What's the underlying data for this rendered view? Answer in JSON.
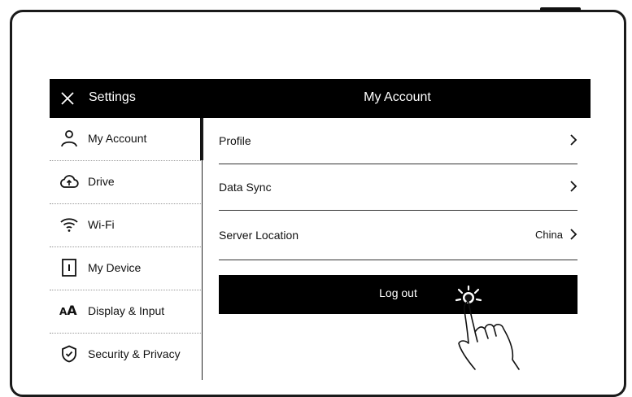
{
  "header": {
    "settings_label": "Settings",
    "page_title": "My Account"
  },
  "sidebar": {
    "items": [
      {
        "label": "My Account",
        "icon": "user-icon",
        "active": true
      },
      {
        "label": "Drive",
        "icon": "cloud-icon",
        "active": false
      },
      {
        "label": "Wi-Fi",
        "icon": "wifi-icon",
        "active": false
      },
      {
        "label": "My Device",
        "icon": "device-icon",
        "active": false
      },
      {
        "label": "Display & Input",
        "icon": "text-size-icon",
        "active": false
      },
      {
        "label": "Security & Privacy",
        "icon": "shield-icon",
        "active": false
      }
    ]
  },
  "account": {
    "profile_label": "Profile",
    "data_sync_label": "Data Sync",
    "server_location_label": "Server Location",
    "server_location_value": "China",
    "logout_label": "Log out"
  },
  "icons": {
    "aa_large": "A",
    "aa_small": "A"
  },
  "colors": {
    "bar": "#000000",
    "background": "#ffffff",
    "text": "#111111"
  }
}
